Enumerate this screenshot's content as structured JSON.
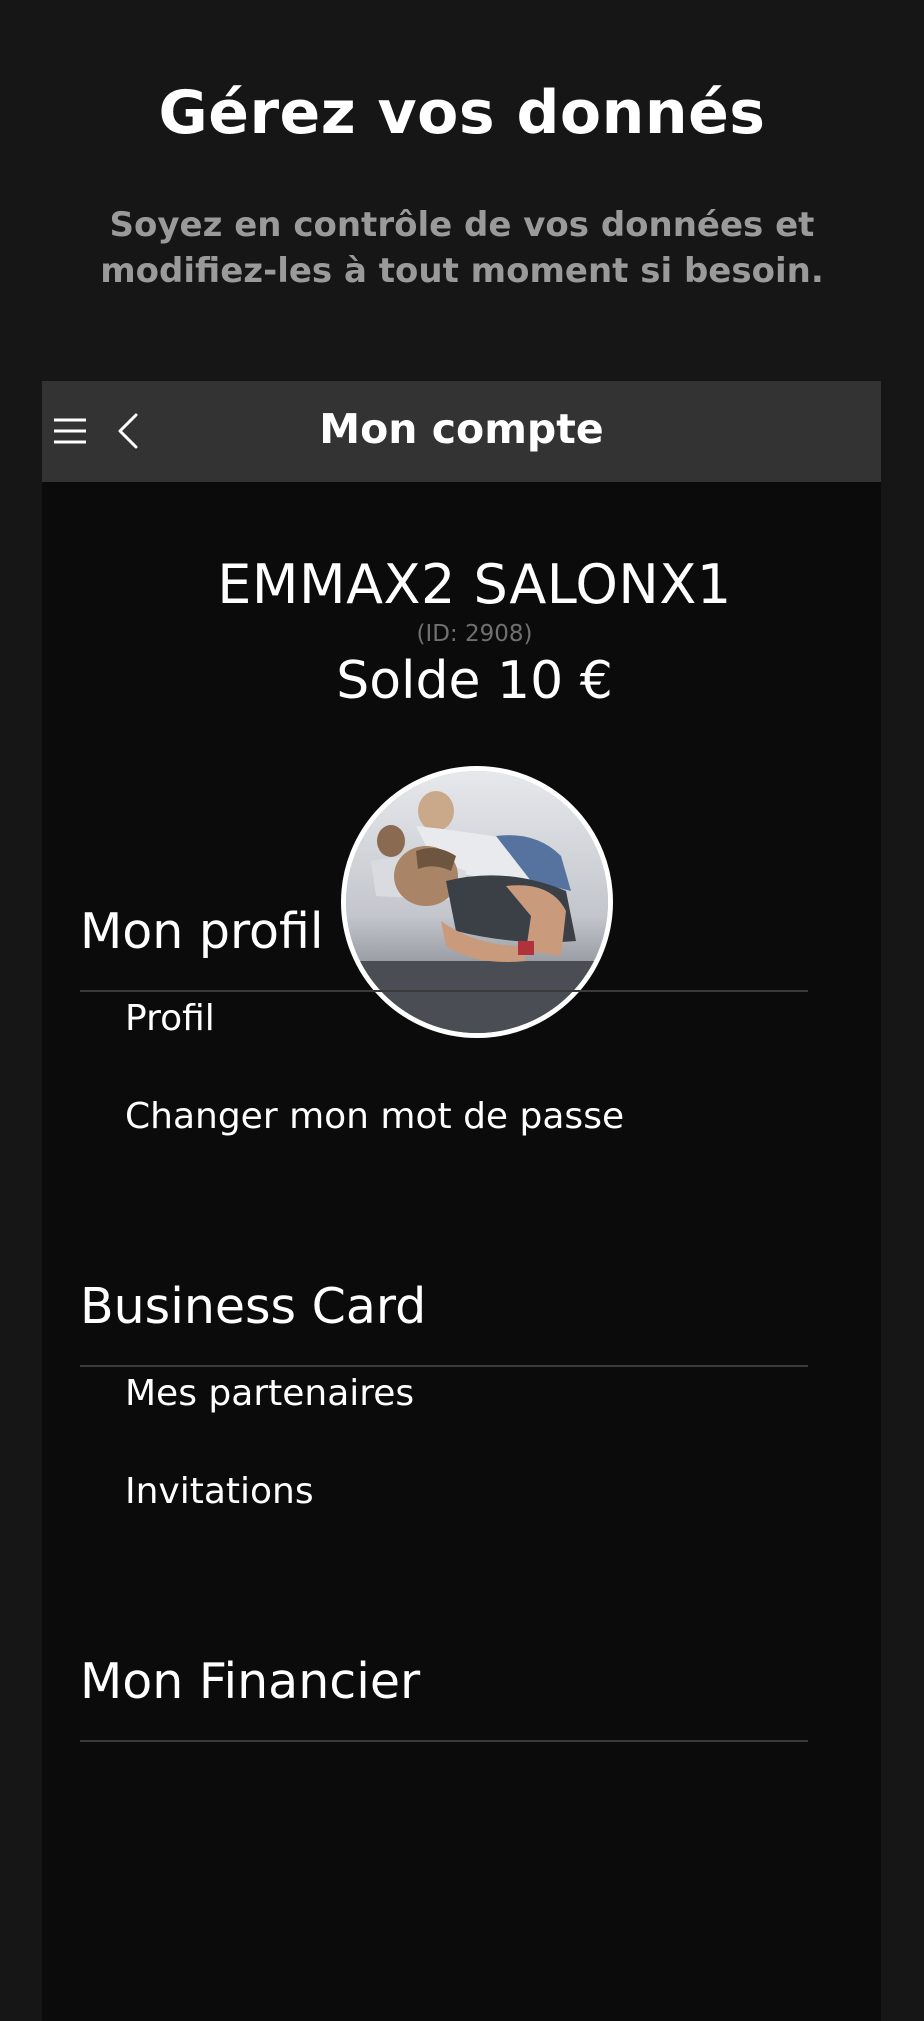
{
  "promo": {
    "title": "Gérez vos donnés",
    "subtitle": "Soyez en contrôle de vos données et modifiez-les à tout moment si besoin."
  },
  "topbar": {
    "title": "Mon compte",
    "menu_icon": "hamburger-menu-icon",
    "back_icon": "chevron-left-icon"
  },
  "account": {
    "name": "EMMAX2 SALONX1",
    "id": "(ID: 2908)",
    "balance": "Solde 10 €"
  },
  "sections": [
    {
      "title": "Mon profil",
      "items": [
        "Profil",
        "Changer mon mot de passe"
      ]
    },
    {
      "title": "Business Card",
      "items": [
        "Mes partenaires",
        "Invitations"
      ]
    },
    {
      "title": "Mon Financier",
      "items": []
    }
  ],
  "colors": {
    "page_background": "#161616",
    "phone_background": "#0b0b0b",
    "topbar_background": "#333333",
    "subtitle_text": "#9a9a9a",
    "divider": "#3a3a3a"
  }
}
